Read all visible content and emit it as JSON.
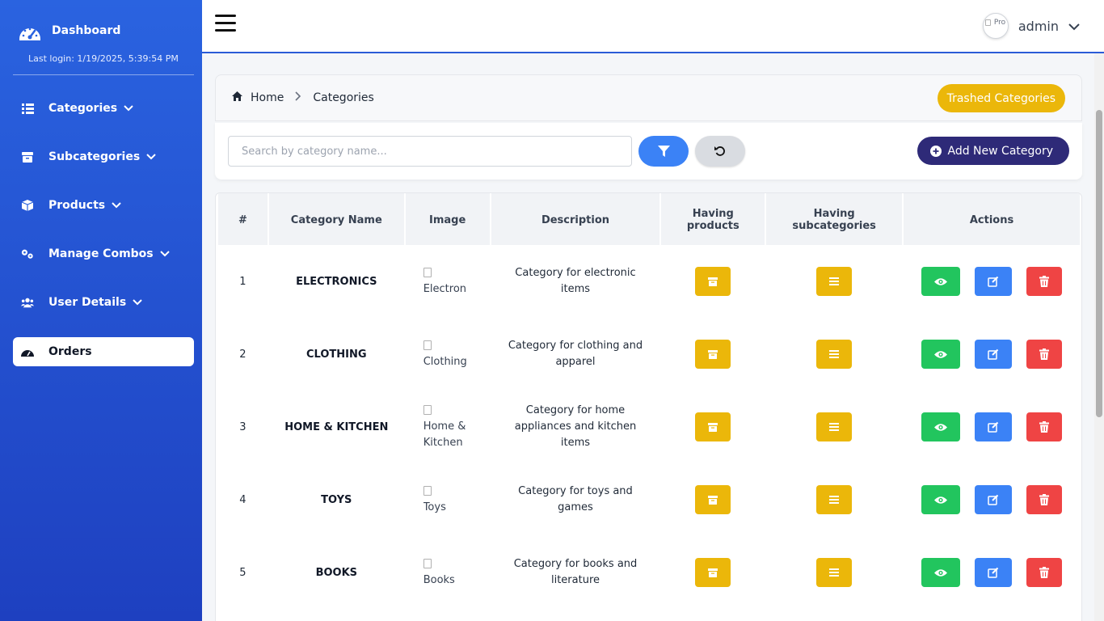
{
  "sidebar": {
    "title": "Dashboard",
    "last_login": "Last login: 1/19/2025, 5:39:54 PM",
    "items": [
      {
        "label": "Categories",
        "icon": "list-icon"
      },
      {
        "label": "Subcategories",
        "icon": "box-icon"
      },
      {
        "label": "Products",
        "icon": "cube-icon"
      },
      {
        "label": "Manage Combos",
        "icon": "gears-icon"
      },
      {
        "label": "User Details",
        "icon": "users-icon"
      },
      {
        "label": "Orders",
        "icon": "gauge-icon",
        "active": true
      }
    ]
  },
  "topbar": {
    "avatar_alt": "Pro",
    "username": "admin"
  },
  "breadcrumb": {
    "home": "Home",
    "current": "Categories"
  },
  "trashed_button": "Trashed Categories",
  "search": {
    "placeholder": "Search by category name..."
  },
  "add_button": "Add New Category",
  "table": {
    "headers": [
      "#",
      "Category Name",
      "Image",
      "Description",
      "Having products",
      "Having subcategories",
      "Actions"
    ],
    "header_lines": {
      "having_products": [
        "Having",
        "products"
      ],
      "having_subcategories": [
        "Having",
        "subcategories"
      ]
    },
    "rows": [
      {
        "num": "1",
        "name": "ELECTRONICS",
        "image_alt": [
          "Electron"
        ],
        "description": "Category for electronic items"
      },
      {
        "num": "2",
        "name": "CLOTHING",
        "image_alt": [
          "Clothing"
        ],
        "description": "Category for clothing and apparel"
      },
      {
        "num": "3",
        "name": "HOME & KITCHEN",
        "image_alt": [
          "Home &",
          "Kitchen"
        ],
        "description": "Category for home appliances and kitchen items"
      },
      {
        "num": "4",
        "name": "TOYS",
        "image_alt": [
          "Toys"
        ],
        "description": "Category for toys and games"
      },
      {
        "num": "5",
        "name": "BOOKS",
        "image_alt": [
          "Books"
        ],
        "description": "Category for books and literature"
      }
    ]
  },
  "colors": {
    "sidebar": "#2a63e0",
    "yellow": "#ebb70a",
    "green": "#22c55e",
    "blue": "#3b82f6",
    "red": "#ef4444",
    "navy": "#2e2a78"
  }
}
